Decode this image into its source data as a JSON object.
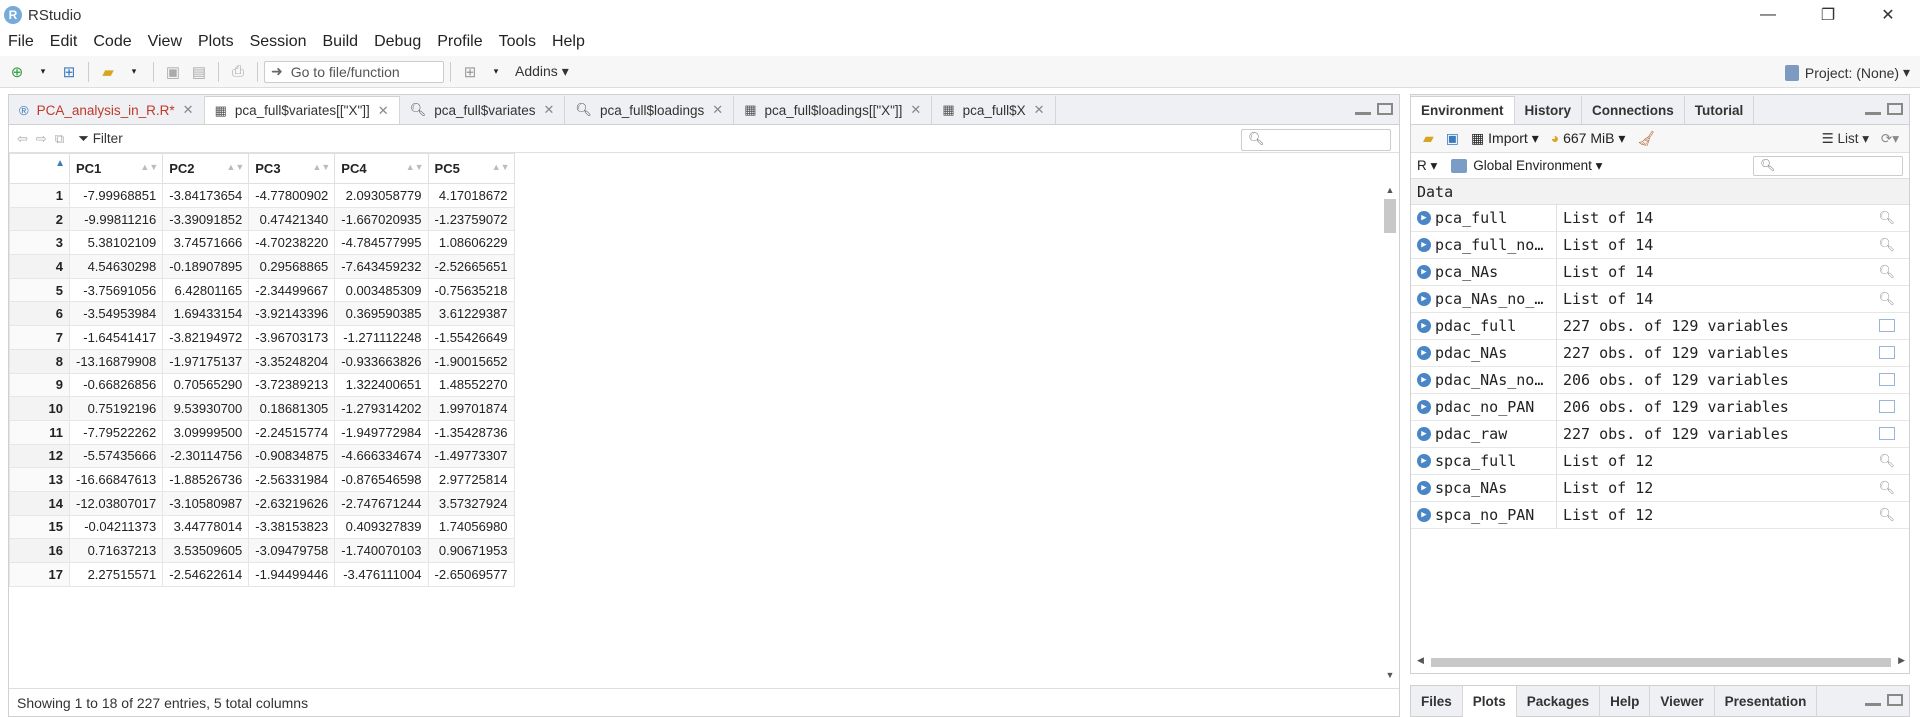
{
  "window": {
    "title": "RStudio",
    "app_icon_letter": "R",
    "controls": {
      "minimize": "—",
      "restore": "❐",
      "close": "✕"
    }
  },
  "menu": [
    "File",
    "Edit",
    "Code",
    "View",
    "Plots",
    "Session",
    "Build",
    "Debug",
    "Profile",
    "Tools",
    "Help"
  ],
  "toolbar": {
    "goto_placeholder": "Go to file/function",
    "addins_label": "Addins",
    "project_label": "Project: (None)"
  },
  "source_tabs": [
    {
      "label": "PCA_analysis_in_R.R*",
      "icon": "r-script-icon"
    },
    {
      "label": "pca_full$variates[[\"X\"]]",
      "icon": "table-icon"
    },
    {
      "label": "pca_full$variates",
      "icon": "search-icon"
    },
    {
      "label": "pca_full$loadings",
      "icon": "search-icon"
    },
    {
      "label": "pca_full$loadings[[\"X\"]]",
      "icon": "table-icon"
    },
    {
      "label": "pca_full$X",
      "icon": "table-icon"
    }
  ],
  "viewer": {
    "filter_label": "Filter",
    "columns": [
      "PC1",
      "PC2",
      "PC3",
      "PC4",
      "PC5"
    ],
    "rows": [
      [
        "1",
        "-7.99968851",
        "-3.84173654",
        "-4.77800902",
        "2.093058779",
        "4.17018672"
      ],
      [
        "2",
        "-9.99811216",
        "-3.39091852",
        "0.47421340",
        "-1.667020935",
        "-1.23759072"
      ],
      [
        "3",
        "5.38102109",
        "3.74571666",
        "-4.70238220",
        "-4.784577995",
        "1.08606229"
      ],
      [
        "4",
        "4.54630298",
        "-0.18907895",
        "0.29568865",
        "-7.643459232",
        "-2.52665651"
      ],
      [
        "5",
        "-3.75691056",
        "6.42801165",
        "-2.34499667",
        "0.003485309",
        "-0.75635218"
      ],
      [
        "6",
        "-3.54953984",
        "1.69433154",
        "-3.92143396",
        "0.369590385",
        "3.61229387"
      ],
      [
        "7",
        "-1.64541417",
        "-3.82194972",
        "-3.96703173",
        "-1.271112248",
        "-1.55426649"
      ],
      [
        "8",
        "-13.16879908",
        "-1.97175137",
        "-3.35248204",
        "-0.933663826",
        "-1.90015652"
      ],
      [
        "9",
        "-0.66826856",
        "0.70565290",
        "-3.72389213",
        "1.322400651",
        "1.48552270"
      ],
      [
        "10",
        "0.75192196",
        "9.53930700",
        "0.18681305",
        "-1.279314202",
        "1.99701874"
      ],
      [
        "11",
        "-7.79522262",
        "3.09999500",
        "-2.24515774",
        "-1.949772984",
        "-1.35428736"
      ],
      [
        "12",
        "-5.57435666",
        "-2.30114756",
        "-0.90834875",
        "-4.666334674",
        "-1.49773307"
      ],
      [
        "13",
        "-16.66847613",
        "-1.88526736",
        "-2.56331984",
        "-0.876546598",
        "2.97725814"
      ],
      [
        "14",
        "-12.03807017",
        "-3.10580987",
        "-2.63219626",
        "-2.747671244",
        "3.57327924"
      ],
      [
        "15",
        "-0.04211373",
        "3.44778014",
        "-3.38153823",
        "0.409327839",
        "1.74056980"
      ],
      [
        "16",
        "0.71637213",
        "3.53509605",
        "-3.09479758",
        "-1.740070103",
        "0.90671953"
      ],
      [
        "17",
        "2.27515571",
        "-2.54622614",
        "-1.94499446",
        "-3.476111004",
        "-2.65069577"
      ]
    ],
    "status": "Showing 1 to 18 of 227 entries, 5 total columns"
  },
  "env_tabs": [
    "Environment",
    "History",
    "Connections",
    "Tutorial"
  ],
  "env_toolbar": {
    "import_label": "Import",
    "memory_label": "667 MiB",
    "view_mode": "List"
  },
  "env_scope": {
    "language": "R",
    "environment": "Global Environment"
  },
  "data_header": "Data",
  "env_objects": [
    {
      "name": "pca_full",
      "value": "List of  14",
      "kind": "list"
    },
    {
      "name": "pca_full_no…",
      "value": "List of  14",
      "kind": "list"
    },
    {
      "name": "pca_NAs",
      "value": "List of  14",
      "kind": "list"
    },
    {
      "name": "pca_NAs_no_…",
      "value": "List of  14",
      "kind": "list"
    },
    {
      "name": "pdac_full",
      "value": "227 obs. of 129 variables",
      "kind": "df"
    },
    {
      "name": "pdac_NAs",
      "value": "227 obs. of 129 variables",
      "kind": "df"
    },
    {
      "name": "pdac_NAs_no…",
      "value": "206 obs. of 129 variables",
      "kind": "df"
    },
    {
      "name": "pdac_no_PAN",
      "value": "206 obs. of 129 variables",
      "kind": "df"
    },
    {
      "name": "pdac_raw",
      "value": "227 obs. of 129 variables",
      "kind": "df"
    },
    {
      "name": "spca_full",
      "value": "List of  12",
      "kind": "list"
    },
    {
      "name": "spca_NAs",
      "value": "List of  12",
      "kind": "list"
    },
    {
      "name": "spca_no_PAN",
      "value": "List of  12",
      "kind": "list"
    }
  ],
  "bottom_tabs": [
    "Files",
    "Plots",
    "Packages",
    "Help",
    "Viewer",
    "Presentation"
  ],
  "colors": {
    "accent": "#75aadb",
    "script_tab": "#c0392b"
  }
}
